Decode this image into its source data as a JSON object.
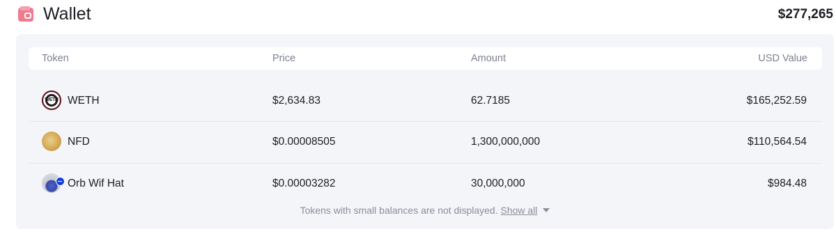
{
  "header": {
    "title": "Wallet",
    "total_value": "$277,265",
    "icon": "wallet-icon",
    "icon_color": "#f07a8e"
  },
  "table": {
    "columns": {
      "token": "Token",
      "price": "Price",
      "amount": "Amount",
      "usd_value": "USD Value"
    },
    "rows": [
      {
        "token": "WETH",
        "logo_text": "WETH",
        "price": "$2,634.83",
        "amount": "62.7185",
        "usd_value": "$165,252.59"
      },
      {
        "token": "NFD",
        "price": "$0.00008505",
        "amount": "1,300,000,000",
        "usd_value": "$110,564.54"
      },
      {
        "token": "Orb Wif Hat",
        "price": "$0.00003282",
        "amount": "30,000,000",
        "usd_value": "$984.48"
      }
    ]
  },
  "footer": {
    "note": "Tokens with small balances are not displayed.",
    "show_all_label": "Show all",
    "icon": "caret-down-icon"
  }
}
